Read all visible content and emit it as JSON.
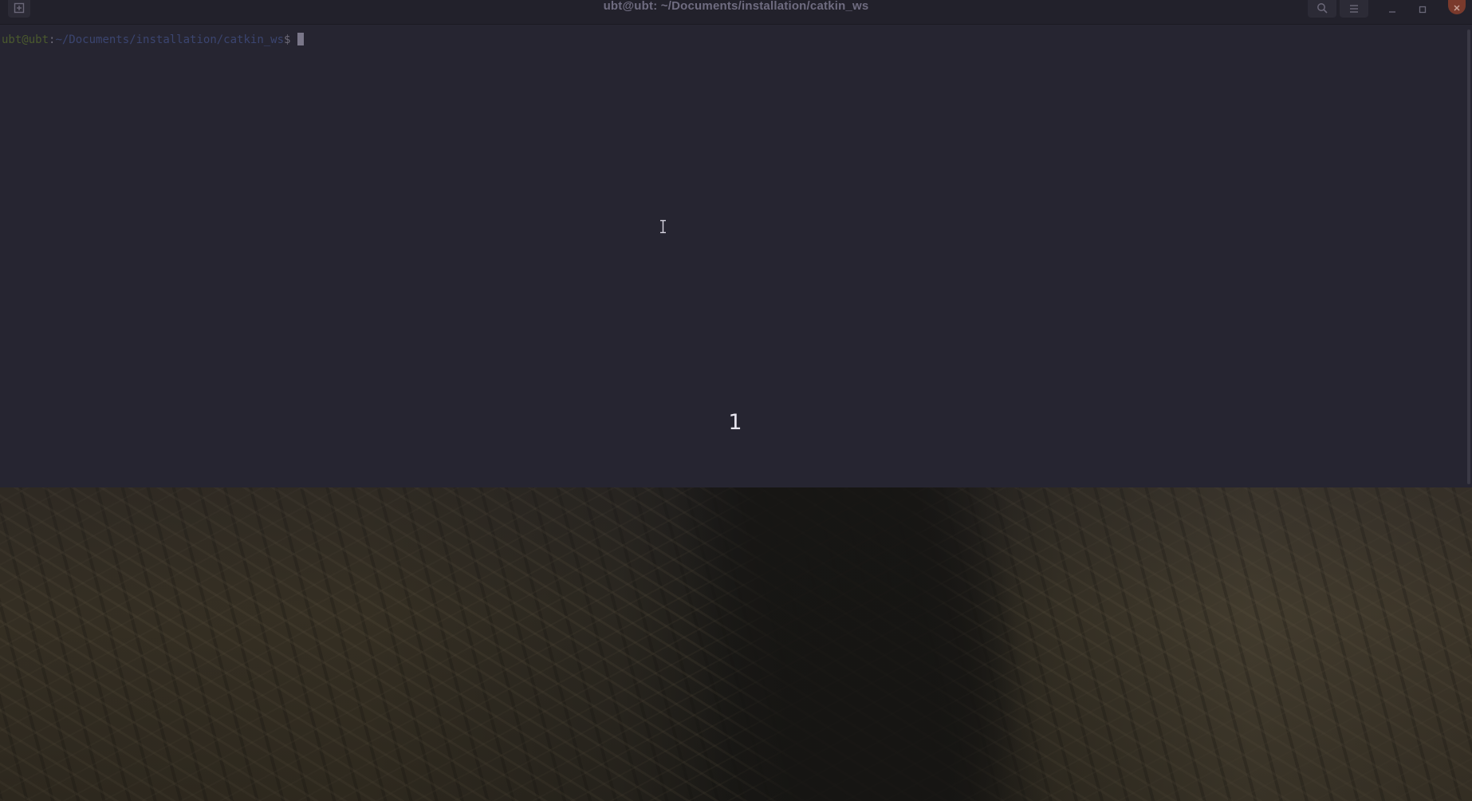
{
  "window": {
    "title": "ubt@ubt: ~/Documents/installation/catkin_ws"
  },
  "icons": {
    "new_tab": "new-tab-icon",
    "search": "search-icon",
    "menu": "hamburger-menu-icon",
    "minimize": "minimize-icon",
    "maximize": "maximize-icon",
    "close": "close-icon",
    "text_cursor": "i-beam-cursor-icon"
  },
  "terminal": {
    "prompt_user": "ubt@ubt",
    "prompt_sep": ":",
    "prompt_path": "~/Documents/installation/catkin_ws",
    "prompt_symbol": "$"
  },
  "overlay": {
    "slide_number": "1"
  },
  "colors": {
    "terminal_bg": "#262531",
    "prompt_user": "#4b5a2e",
    "prompt_path": "#3b4570",
    "close_button": "#7a3a2c"
  }
}
